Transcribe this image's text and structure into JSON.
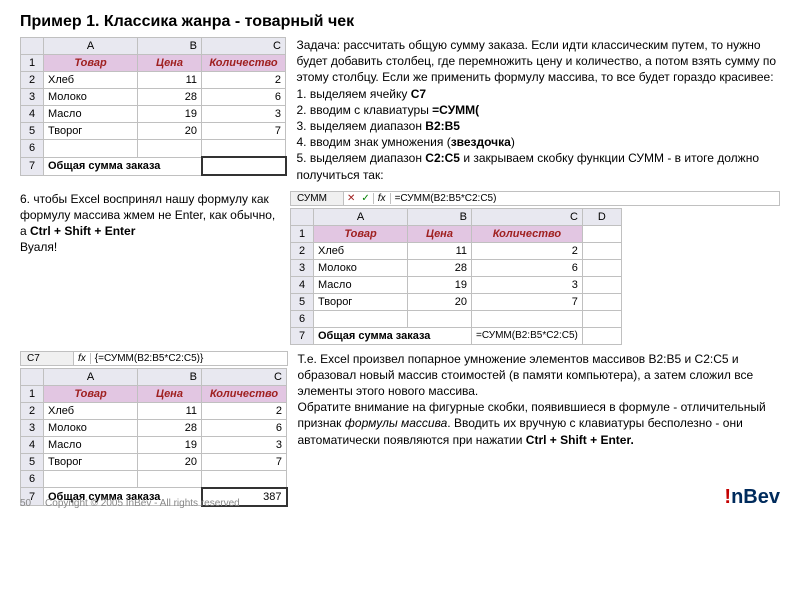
{
  "title": "Пример 1. Классика жанра - товарный чек",
  "task_intro": "Задача: рассчитать общую сумму заказа. Если идти классическим путем, то нужно будет добавить столбец, где перемножить цену и количество, а потом взять сумму по этому столбцу. Если же применить формулу массива, то все будет гораздо красивее:",
  "steps": {
    "s1a": "1. выделяем ячейку ",
    "s1b": "C7",
    "s2a": "2. вводим с клавиатуры ",
    "s2b": "=СУММ(",
    "s3a": "3. выделяем диапазон ",
    "s3b": "B2:B5",
    "s4a": "4. вводим знак умножения (",
    "s4b": "звездочка",
    "s4c": ")",
    "s5a": "5. выделяем диапазон ",
    "s5b": "C2:C5",
    "s5c": " и закрываем скобку функции СУММ - в итоге должно получиться так:"
  },
  "step6a": "6. чтобы Excel воспринял нашу формулу как формулу массива жмем не Enter, как обычно, а ",
  "step6b": "Ctrl + Shift + Enter",
  "step6c": "Вуаля!",
  "table": {
    "headers": {
      "A": "Товар",
      "B": "Цена",
      "C": "Количество"
    },
    "rows": [
      {
        "A": "Хлеб",
        "B": "11",
        "C": "2"
      },
      {
        "A": "Молоко",
        "B": "28",
        "C": "6"
      },
      {
        "A": "Масло",
        "B": "19",
        "C": "3"
      },
      {
        "A": "Творог",
        "B": "20",
        "C": "7"
      }
    ],
    "total_label": "Общая сумма заказа",
    "total_value": "387"
  },
  "fxbar1": {
    "name": "C7",
    "formula": "{=СУММ(B2:B5*C2:C5)}"
  },
  "fxbar2": {
    "name": "СУММ",
    "formula": "=СУММ(B2:B5*C2:C5)"
  },
  "cell_formula": "=СУММ(B2:B5*C2:C5)",
  "desc2a": "Т.е. Excel произвел попарное умножение элементов массивов B2:B5 и C2:C5 и образовал новый массив стоимостей (в памяти компьютера), а затем сложил все элементы этого нового массива.",
  "desc2b": "Обратите внимание на фигурные скобки, появившиеся в формуле - отличительный признак ",
  "desc2c": "формулы массива",
  "desc2d": ". Вводить их вручную с клавиатуры бесполезно - они автоматически появляются при нажатии ",
  "desc2e": "Ctrl + Shift + Enter.",
  "footer": {
    "page": "50",
    "copyright": "Copyright © 2005 InBev - All rights reserved"
  },
  "cols": {
    "A": "A",
    "B": "B",
    "C": "C",
    "D": "D"
  },
  "fx": "fx"
}
